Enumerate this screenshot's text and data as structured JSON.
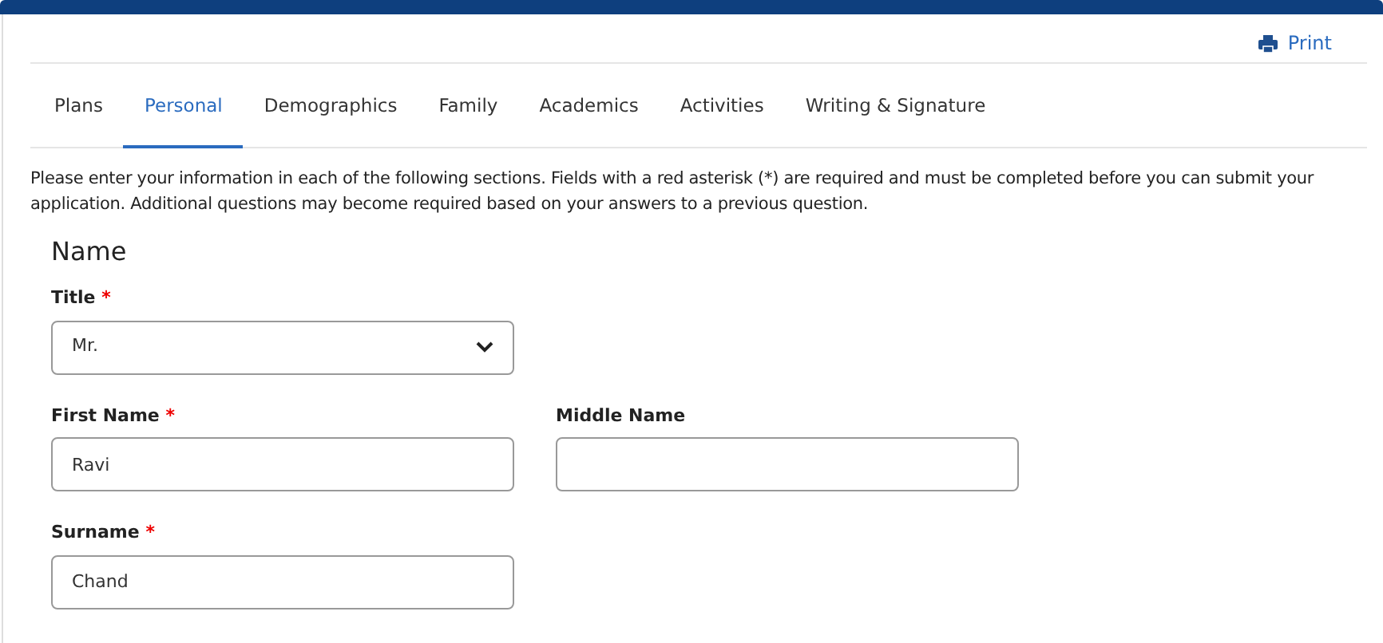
{
  "toolbar": {
    "print_label": "Print"
  },
  "tabs": [
    {
      "label": "Plans",
      "selected": false
    },
    {
      "label": "Personal",
      "selected": true
    },
    {
      "label": "Demographics",
      "selected": false
    },
    {
      "label": "Family",
      "selected": false
    },
    {
      "label": "Academics",
      "selected": false
    },
    {
      "label": "Activities",
      "selected": false
    },
    {
      "label": "Writing & Signature",
      "selected": false
    }
  ],
  "instructions": "Please enter your information in each of the following sections. Fields with a red asterisk (*) are required and must be completed before you can submit your application. Additional questions may become required based on your answers to a previous question.",
  "section": {
    "heading": "Name",
    "rows": [
      [
        {
          "label": "Title",
          "required_mark": "*",
          "kind": "select",
          "value": "Mr."
        }
      ],
      [
        {
          "label": "First Name",
          "required_mark": "*",
          "kind": "input",
          "value": "Ravi"
        },
        {
          "label": "Middle Name",
          "kind": "input"
        }
      ],
      [
        {
          "label": "Surname",
          "required_mark": "*",
          "kind": "input",
          "value": "Chand"
        }
      ]
    ]
  }
}
